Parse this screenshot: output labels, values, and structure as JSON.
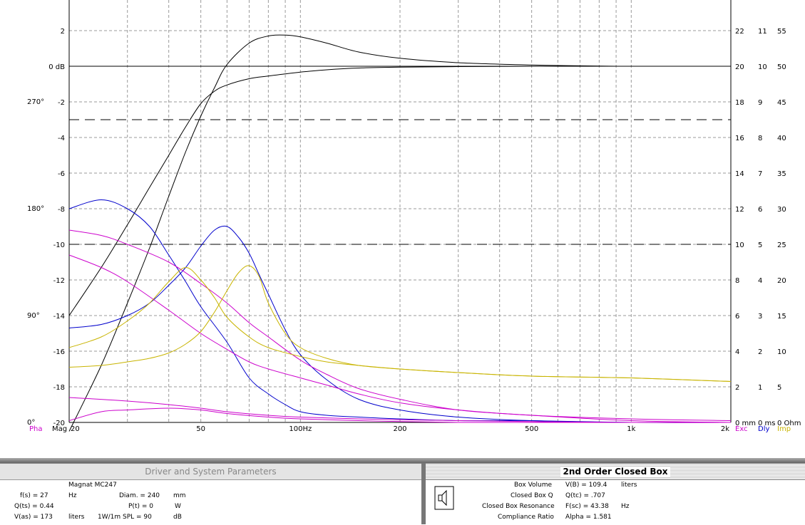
{
  "chart_data": {
    "type": "line",
    "x_axis": {
      "scale": "log",
      "range": [
        20,
        2000
      ],
      "ticks": [
        {
          "v": 20,
          "label": "20"
        },
        {
          "v": 50,
          "label": "50"
        },
        {
          "v": 100,
          "label": "100Hz"
        },
        {
          "v": 200,
          "label": "200"
        },
        {
          "v": 500,
          "label": "500"
        },
        {
          "v": 1000,
          "label": "1k"
        },
        {
          "v": 2000,
          "label": "2k"
        }
      ],
      "left_label": "Mag"
    },
    "y_mag": {
      "range": [
        -20,
        4
      ],
      "labels": [
        {
          "v": 2,
          "t": "2"
        },
        {
          "v": 0,
          "t": "0 dB"
        },
        {
          "v": -2,
          "t": "-2"
        },
        {
          "v": -4,
          "t": "-4"
        },
        {
          "v": -6,
          "t": "-6"
        },
        {
          "v": -8,
          "t": "-8"
        },
        {
          "v": -10,
          "t": "-10"
        },
        {
          "v": -12,
          "t": "-12"
        },
        {
          "v": -14,
          "t": "-14"
        },
        {
          "v": -16,
          "t": "-16"
        },
        {
          "v": -18,
          "t": "-18"
        },
        {
          "v": -20,
          "t": "-20"
        }
      ]
    },
    "y_phase": {
      "labels": [
        {
          "v": -2,
          "t": "270°"
        },
        {
          "v": -8,
          "t": "180°"
        },
        {
          "v": -14,
          "t": "90°"
        },
        {
          "v": -20,
          "t": "0°"
        }
      ],
      "axis_name": "Pha"
    },
    "right_axes": [
      {
        "name": "Exc",
        "color": "#cc00cc",
        "labels": [
          {
            "v": 2,
            "t": "22"
          },
          {
            "v": 0,
            "t": "20"
          },
          {
            "v": -2,
            "t": "18"
          },
          {
            "v": -4,
            "t": "16"
          },
          {
            "v": -6,
            "t": "14"
          },
          {
            "v": -8,
            "t": "12"
          },
          {
            "v": -10,
            "t": "10"
          },
          {
            "v": -12,
            "t": "8"
          },
          {
            "v": -14,
            "t": "6"
          },
          {
            "v": -16,
            "t": "4"
          },
          {
            "v": -18,
            "t": "2"
          },
          {
            "v": -20,
            "t": "0 mm"
          }
        ]
      },
      {
        "name": "Dly",
        "color": "#0000cc",
        "labels": [
          {
            "v": 2,
            "t": "11"
          },
          {
            "v": 0,
            "t": "10"
          },
          {
            "v": -2,
            "t": "9"
          },
          {
            "v": -4,
            "t": "8"
          },
          {
            "v": -6,
            "t": "7"
          },
          {
            "v": -8,
            "t": "6"
          },
          {
            "v": -10,
            "t": "5"
          },
          {
            "v": -12,
            "t": "4"
          },
          {
            "v": -14,
            "t": "3"
          },
          {
            "v": -16,
            "t": "2"
          },
          {
            "v": -18,
            "t": "1"
          },
          {
            "v": -20,
            "t": "0 ms"
          }
        ]
      },
      {
        "name": "Imp",
        "color": "#c8b400",
        "labels": [
          {
            "v": 2,
            "t": "55"
          },
          {
            "v": 0,
            "t": "50"
          },
          {
            "v": -2,
            "t": "45"
          },
          {
            "v": -4,
            "t": "40"
          },
          {
            "v": -6,
            "t": "35"
          },
          {
            "v": -8,
            "t": "30"
          },
          {
            "v": -10,
            "t": "25"
          },
          {
            "v": -12,
            "t": "20"
          },
          {
            "v": -14,
            "t": "15"
          },
          {
            "v": -16,
            "t": "10"
          },
          {
            "v": -18,
            "t": "5"
          },
          {
            "v": -20,
            "t": "0 Ohm"
          }
        ]
      }
    ],
    "reference_lines": [
      {
        "y": 0,
        "style": "solid"
      },
      {
        "y": -3,
        "style": "dashed"
      },
      {
        "y": -10,
        "style": "dashed"
      }
    ],
    "series": [
      {
        "color": "#000000",
        "x": [
          20,
          25,
          30,
          35,
          40,
          45,
          50,
          55,
          60,
          70,
          80,
          90,
          100,
          120,
          150,
          200,
          300,
          500,
          900
        ],
        "y": [
          -14,
          -11.3,
          -8.9,
          -6.8,
          -5,
          -3.4,
          -2.1,
          -1.4,
          -1.05,
          -0.7,
          -0.55,
          -0.43,
          -0.33,
          -0.2,
          -0.1,
          -0.05,
          -0.02,
          0,
          0
        ]
      },
      {
        "color": "#000000",
        "x": [
          20,
          25,
          30,
          35,
          40,
          45,
          50,
          55,
          60,
          70,
          80,
          90,
          100,
          120,
          150,
          200,
          300,
          500,
          900
        ],
        "y": [
          -20.5,
          -16.8,
          -13.3,
          -10.2,
          -7.3,
          -4.8,
          -2.8,
          -1.2,
          0.1,
          1.3,
          1.7,
          1.75,
          1.65,
          1.3,
          0.8,
          0.45,
          0.2,
          0.07,
          0
        ]
      },
      {
        "color": "#0000cc",
        "x": [
          20,
          25,
          30,
          35,
          40,
          45,
          50,
          60,
          70,
          80,
          90,
          100,
          120,
          150,
          200,
          300,
          500,
          1000,
          2000
        ],
        "y": [
          -8,
          -7.5,
          -8,
          -9,
          -10.6,
          -12.1,
          -13.5,
          -15.5,
          -17.5,
          -18.4,
          -19,
          -19.4,
          -19.6,
          -19.7,
          -19.8,
          -19.9,
          -19.9,
          -20,
          -20
        ]
      },
      {
        "color": "#0000cc",
        "x": [
          20,
          25,
          30,
          35,
          40,
          45,
          50,
          55,
          60,
          65,
          70,
          75,
          80,
          90,
          100,
          120,
          150,
          200,
          300,
          500,
          1000,
          2000
        ],
        "y": [
          -14.7,
          -14.5,
          -14,
          -13.3,
          -12.3,
          -11.3,
          -10.1,
          -9.2,
          -9,
          -9.6,
          -10.5,
          -11.7,
          -12.8,
          -14.8,
          -16.2,
          -17.6,
          -18.7,
          -19.3,
          -19.7,
          -19.9,
          -20,
          -20
        ]
      },
      {
        "color": "#cc00cc",
        "x": [
          20,
          25,
          30,
          40,
          50,
          60,
          70,
          80,
          100,
          120,
          150,
          200,
          300,
          500,
          1000,
          2000
        ],
        "y": [
          -9.2,
          -9.5,
          -10,
          -11,
          -12.2,
          -13.3,
          -14.4,
          -15.2,
          -16.5,
          -17.3,
          -18.1,
          -18.7,
          -19.3,
          -19.6,
          -19.9,
          -20
        ]
      },
      {
        "color": "#cc00cc",
        "x": [
          20,
          25,
          30,
          40,
          50,
          60,
          70,
          80,
          100,
          120,
          150,
          200,
          300,
          500,
          1000,
          2000
        ],
        "y": [
          -10.6,
          -11.3,
          -12.1,
          -13.7,
          -15,
          -15.9,
          -16.6,
          -17,
          -17.5,
          -17.9,
          -18.4,
          -18.9,
          -19.3,
          -19.6,
          -19.8,
          -19.9
        ]
      },
      {
        "color": "#cc00cc",
        "x": [
          20,
          30,
          40,
          50,
          60,
          80,
          100,
          150,
          200,
          300,
          500,
          1000,
          2000
        ],
        "y": [
          -18.6,
          -18.8,
          -19,
          -19.2,
          -19.4,
          -19.6,
          -19.7,
          -19.8,
          -19.85,
          -19.9,
          -19.95,
          -20,
          -20
        ]
      },
      {
        "color": "#cc00cc",
        "x": [
          20,
          25,
          30,
          40,
          50,
          60,
          80,
          100,
          150,
          200,
          300,
          500,
          1000,
          2000
        ],
        "y": [
          -19.9,
          -19.4,
          -19.3,
          -19.2,
          -19.3,
          -19.5,
          -19.7,
          -19.8,
          -19.9,
          -19.95,
          -20,
          -20,
          -20,
          -20
        ]
      },
      {
        "color": "#c8b400",
        "x": [
          20,
          25,
          30,
          35,
          40,
          45,
          50,
          55,
          60,
          70,
          80,
          100,
          120,
          150,
          200,
          300,
          500,
          1000,
          2000
        ],
        "y": [
          -15.8,
          -15.2,
          -14.3,
          -13.3,
          -12.1,
          -11.3,
          -12,
          -13,
          -14.1,
          -15.2,
          -15.8,
          -16.3,
          -16.6,
          -16.8,
          -17,
          -17.2,
          -17.4,
          -17.5,
          -17.7
        ]
      },
      {
        "color": "#c8b400",
        "x": [
          20,
          25,
          30,
          35,
          40,
          45,
          50,
          55,
          60,
          65,
          70,
          75,
          80,
          90,
          100,
          120,
          150,
          200,
          300,
          500,
          1000,
          2000
        ],
        "y": [
          -16.9,
          -16.8,
          -16.6,
          -16.4,
          -16.1,
          -15.6,
          -14.9,
          -13.8,
          -12.6,
          -11.6,
          -11.2,
          -11.8,
          -13.3,
          -15,
          -15.8,
          -16.4,
          -16.8,
          -17,
          -17.2,
          -17.4,
          -17.5,
          -17.7
        ]
      }
    ]
  },
  "left_panel": {
    "title": "Driver and System Parameters",
    "driver_name": "Magnat  MC247",
    "fs_label": "f(s) = 27",
    "fs_unit": "Hz",
    "qts_label": "Q(ts) = 0.44",
    "vas_label": "V(as) = 173",
    "vas_unit": "liters",
    "diam_label": "Diam. = 240",
    "diam_unit": "mm",
    "pt_label": "P(t) = 0",
    "pt_unit": "W",
    "spl_label": "1W/1m SPL = 90",
    "spl_unit": "dB"
  },
  "right_panel": {
    "title": "2nd Order Closed Box",
    "rows": [
      {
        "name": "Box Volume",
        "val": "V(B) = 109.4",
        "unit": "liters"
      },
      {
        "name": "Closed Box Q",
        "val": "Q(tc) = .707",
        "unit": ""
      },
      {
        "name": "Closed Box Resonance",
        "val": "F(sc) = 43.38",
        "unit": "Hz"
      },
      {
        "name": "Compliance Ratio",
        "val": "Alpha = 1.581",
        "unit": ""
      }
    ]
  }
}
